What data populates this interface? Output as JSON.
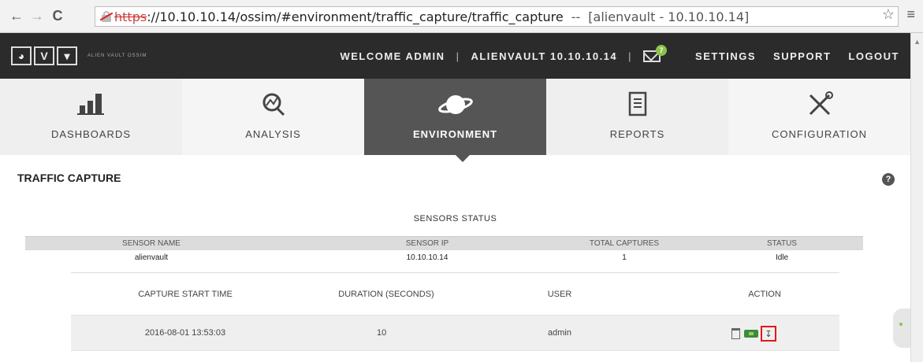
{
  "browser": {
    "scheme": "https",
    "url_rest": "://10.10.10.14/ossim/#environment/traffic_capture/traffic_capture",
    "separator": "--",
    "tab_title": "[alienvault - 10.10.10.14]"
  },
  "header": {
    "logo_letters": [
      "◕",
      "V",
      "▾"
    ],
    "logo_text": "ALIEN VAULT OSSIM",
    "welcome": "WELCOME ADMIN",
    "host": "ALIENVAULT 10.10.10.14",
    "mail_count": "7",
    "links": [
      "SETTINGS",
      "SUPPORT",
      "LOGOUT"
    ]
  },
  "nav": {
    "tiles": [
      {
        "label": "DASHBOARDS",
        "icon": "bar-chart-icon"
      },
      {
        "label": "ANALYSIS",
        "icon": "magnifier-icon"
      },
      {
        "label": "ENVIRONMENT",
        "icon": "planet-icon"
      },
      {
        "label": "REPORTS",
        "icon": "document-icon"
      },
      {
        "label": "CONFIGURATION",
        "icon": "tools-icon"
      }
    ],
    "active": "ENVIRONMENT"
  },
  "page": {
    "title": "TRAFFIC CAPTURE",
    "section_title": "SENSORS STATUS"
  },
  "sensors": {
    "columns": [
      "SENSOR NAME",
      "SENSOR IP",
      "TOTAL CAPTURES",
      "STATUS"
    ],
    "rows": [
      {
        "name": "alienvault",
        "ip": "10.10.10.14",
        "total": "1",
        "status": "Idle"
      }
    ]
  },
  "captures": {
    "columns": [
      "CAPTURE START TIME",
      "DURATION (SECONDS)",
      "USER",
      "ACTION"
    ],
    "rows": [
      {
        "start": "2016-08-01 13:53:03",
        "duration": "10",
        "user": "admin",
        "actions": [
          "trash-icon",
          "wireshark-icon",
          "download-icon"
        ]
      }
    ]
  },
  "colors": {
    "header_bg": "#2b2b2b",
    "active_tile": "#555555",
    "badge": "#8bc34a",
    "highlight": "#e21818"
  }
}
